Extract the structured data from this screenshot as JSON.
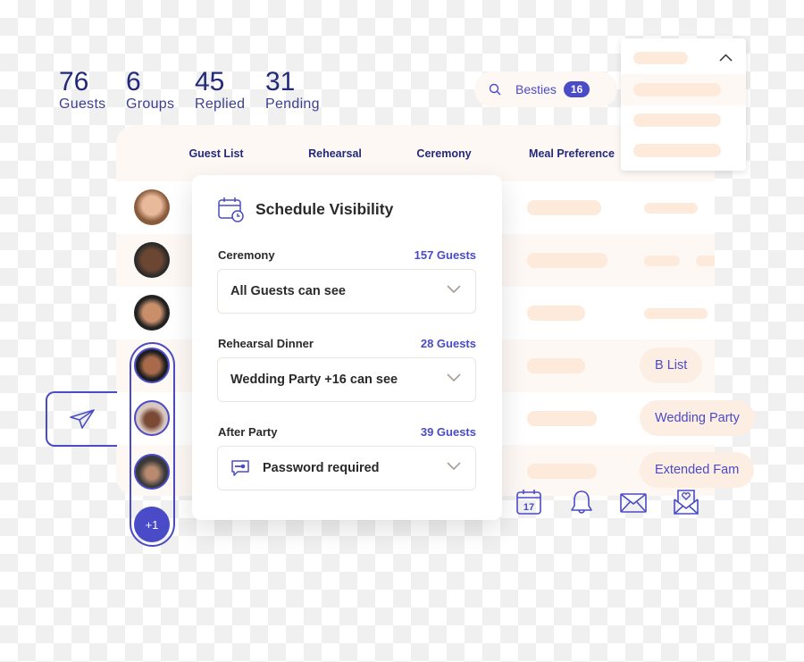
{
  "stats": [
    {
      "value": "76",
      "label": "Guests"
    },
    {
      "value": "6",
      "label": "Groups"
    },
    {
      "value": "45",
      "label": "Replied"
    },
    {
      "value": "31",
      "label": "Pending"
    }
  ],
  "search": {
    "query": "Besties",
    "count": "16"
  },
  "table": {
    "columns": [
      "Guest List",
      "Rehearsal",
      "Ceremony",
      "Meal Preference"
    ]
  },
  "guest_avatars": {
    "more_label": "+1"
  },
  "group_tags": [
    "B List",
    "Wedding Party",
    "Extended Fam"
  ],
  "modal": {
    "title": "Schedule Visibility",
    "fields": [
      {
        "label": "Ceremony",
        "count": "157 Guests",
        "value": "All Guests can see"
      },
      {
        "label": "Rehearsal Dinner",
        "count": "28 Guests",
        "value": "Wedding Party +16 can see"
      },
      {
        "label": "After Party",
        "count": "39 Guests",
        "value": "Password required",
        "icon": "key-chat-icon"
      }
    ]
  },
  "toolbar_icons": [
    "calendar-icon",
    "bell-icon",
    "mail-icon",
    "love-letter-icon"
  ],
  "calendar_day": "17",
  "colors": {
    "accent": "#4a4bc6",
    "navy": "#23297a",
    "peach": "#fdeadb",
    "row_alt": "#fef8f5"
  }
}
